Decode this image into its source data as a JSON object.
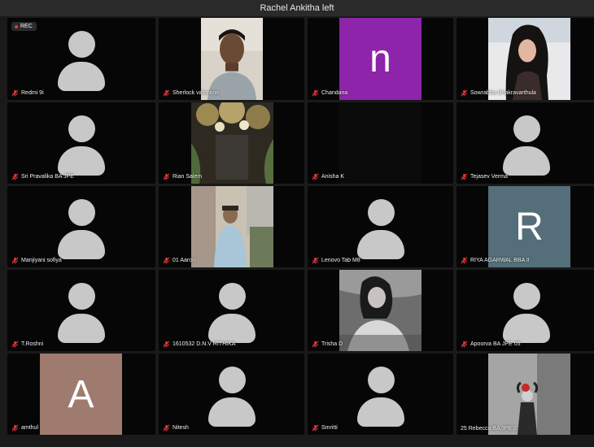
{
  "banner": {
    "text": "Rachel Ankitha left"
  },
  "recording": {
    "label": "REC"
  },
  "colors": {
    "purple_tile": "#8e24aa",
    "slate_tile": "#546e7a",
    "taupe_tile": "#9e7b6e",
    "mic_muted": "#e53935"
  },
  "participants": [
    {
      "name": "Redmi 9i",
      "type": "avatar"
    },
    {
      "name": "Sherlock valentine",
      "type": "video"
    },
    {
      "name": "Chandana",
      "type": "letter",
      "letter": "n"
    },
    {
      "name": "Sowrabha Chakravarthula",
      "type": "video"
    },
    {
      "name": "Sri Pravalika BA JPE",
      "type": "avatar"
    },
    {
      "name": "Rian Salem",
      "type": "video"
    },
    {
      "name": "Anisha K",
      "type": "video"
    },
    {
      "name": "Tejasev Verma",
      "type": "avatar"
    },
    {
      "name": "Manjiyani sofiya",
      "type": "avatar"
    },
    {
      "name": "01 Aaron",
      "type": "video"
    },
    {
      "name": "Lenovo Tab M8",
      "type": "avatar"
    },
    {
      "name": "RIYA AGARWAL BBA II",
      "type": "letter",
      "letter": "R"
    },
    {
      "name": "T.Roshni",
      "type": "avatar"
    },
    {
      "name": "1610532 D.N.V RITHIKA",
      "type": "avatar"
    },
    {
      "name": "Trisha D",
      "type": "video"
    },
    {
      "name": "Apoorva BA JPE 05",
      "type": "avatar"
    },
    {
      "name": "amthul",
      "type": "letter",
      "letter": "A"
    },
    {
      "name": "Nitesh",
      "type": "avatar"
    },
    {
      "name": "Smritti",
      "type": "avatar"
    },
    {
      "name": "25 Rebecca BA JPE 2",
      "type": "video"
    }
  ]
}
